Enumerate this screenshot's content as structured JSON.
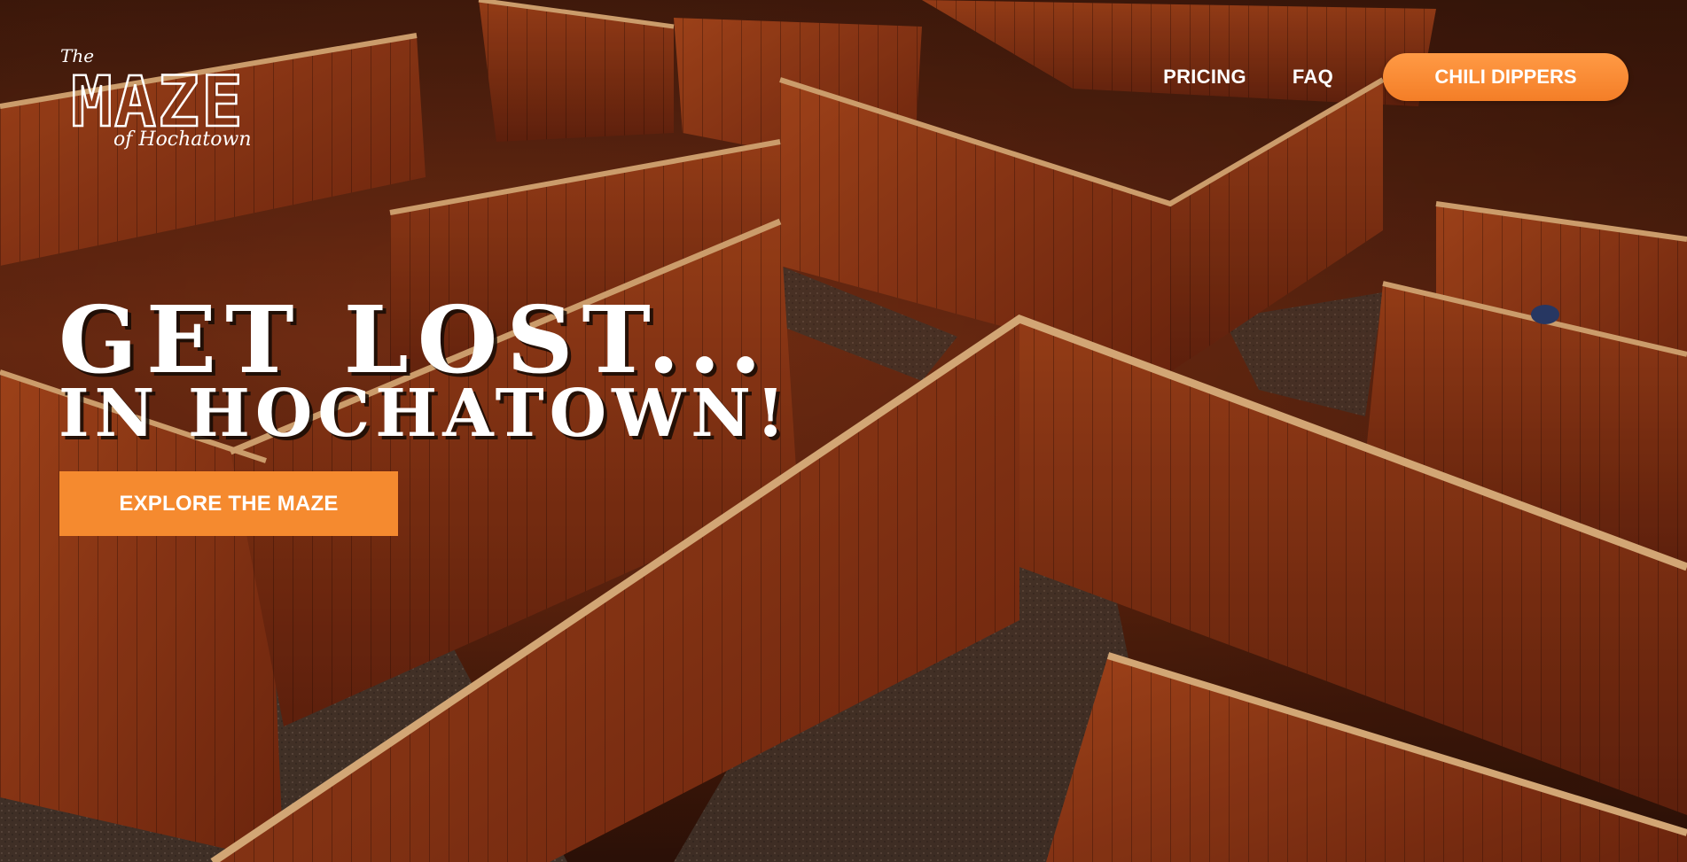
{
  "logo": {
    "the": "The",
    "maze": "MAZE",
    "of_hochatown": "of Hochatown"
  },
  "nav": {
    "pricing": "PRICING",
    "faq": "FAQ",
    "cta": "CHILI DIPPERS"
  },
  "hero": {
    "headline_line1": "GET LOST...",
    "headline_line2": "IN HOCHATOWN!",
    "cta": "EXPLORE THE MAZE"
  },
  "colors": {
    "accent": "#f58a2f",
    "wood": "#8a3617",
    "text": "#ffffff"
  },
  "icons": {
    "logo": "maze-logo-icon",
    "background": "wooden-maze-photo"
  }
}
